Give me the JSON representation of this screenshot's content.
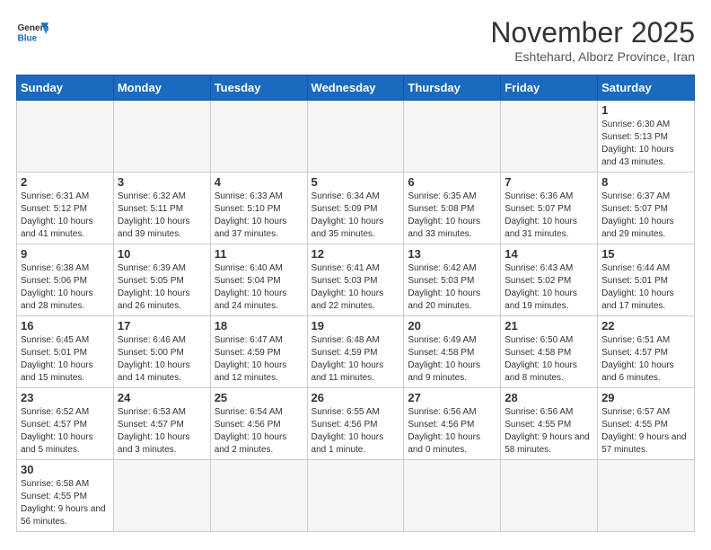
{
  "header": {
    "logo_general": "General",
    "logo_blue": "Blue",
    "month": "November 2025",
    "location": "Eshtehard, Alborz Province, Iran"
  },
  "weekdays": [
    "Sunday",
    "Monday",
    "Tuesday",
    "Wednesday",
    "Thursday",
    "Friday",
    "Saturday"
  ],
  "weeks": [
    {
      "days": [
        {
          "num": "",
          "info": ""
        },
        {
          "num": "",
          "info": ""
        },
        {
          "num": "",
          "info": ""
        },
        {
          "num": "",
          "info": ""
        },
        {
          "num": "",
          "info": ""
        },
        {
          "num": "",
          "info": ""
        },
        {
          "num": "1",
          "info": "Sunrise: 6:30 AM\nSunset: 5:13 PM\nDaylight: 10 hours and 43 minutes."
        }
      ]
    },
    {
      "days": [
        {
          "num": "2",
          "info": "Sunrise: 6:31 AM\nSunset: 5:12 PM\nDaylight: 10 hours and 41 minutes."
        },
        {
          "num": "3",
          "info": "Sunrise: 6:32 AM\nSunset: 5:11 PM\nDaylight: 10 hours and 39 minutes."
        },
        {
          "num": "4",
          "info": "Sunrise: 6:33 AM\nSunset: 5:10 PM\nDaylight: 10 hours and 37 minutes."
        },
        {
          "num": "5",
          "info": "Sunrise: 6:34 AM\nSunset: 5:09 PM\nDaylight: 10 hours and 35 minutes."
        },
        {
          "num": "6",
          "info": "Sunrise: 6:35 AM\nSunset: 5:08 PM\nDaylight: 10 hours and 33 minutes."
        },
        {
          "num": "7",
          "info": "Sunrise: 6:36 AM\nSunset: 5:07 PM\nDaylight: 10 hours and 31 minutes."
        },
        {
          "num": "8",
          "info": "Sunrise: 6:37 AM\nSunset: 5:07 PM\nDaylight: 10 hours and 29 minutes."
        }
      ]
    },
    {
      "days": [
        {
          "num": "9",
          "info": "Sunrise: 6:38 AM\nSunset: 5:06 PM\nDaylight: 10 hours and 28 minutes."
        },
        {
          "num": "10",
          "info": "Sunrise: 6:39 AM\nSunset: 5:05 PM\nDaylight: 10 hours and 26 minutes."
        },
        {
          "num": "11",
          "info": "Sunrise: 6:40 AM\nSunset: 5:04 PM\nDaylight: 10 hours and 24 minutes."
        },
        {
          "num": "12",
          "info": "Sunrise: 6:41 AM\nSunset: 5:03 PM\nDaylight: 10 hours and 22 minutes."
        },
        {
          "num": "13",
          "info": "Sunrise: 6:42 AM\nSunset: 5:03 PM\nDaylight: 10 hours and 20 minutes."
        },
        {
          "num": "14",
          "info": "Sunrise: 6:43 AM\nSunset: 5:02 PM\nDaylight: 10 hours and 19 minutes."
        },
        {
          "num": "15",
          "info": "Sunrise: 6:44 AM\nSunset: 5:01 PM\nDaylight: 10 hours and 17 minutes."
        }
      ]
    },
    {
      "days": [
        {
          "num": "16",
          "info": "Sunrise: 6:45 AM\nSunset: 5:01 PM\nDaylight: 10 hours and 15 minutes."
        },
        {
          "num": "17",
          "info": "Sunrise: 6:46 AM\nSunset: 5:00 PM\nDaylight: 10 hours and 14 minutes."
        },
        {
          "num": "18",
          "info": "Sunrise: 6:47 AM\nSunset: 4:59 PM\nDaylight: 10 hours and 12 minutes."
        },
        {
          "num": "19",
          "info": "Sunrise: 6:48 AM\nSunset: 4:59 PM\nDaylight: 10 hours and 11 minutes."
        },
        {
          "num": "20",
          "info": "Sunrise: 6:49 AM\nSunset: 4:58 PM\nDaylight: 10 hours and 9 minutes."
        },
        {
          "num": "21",
          "info": "Sunrise: 6:50 AM\nSunset: 4:58 PM\nDaylight: 10 hours and 8 minutes."
        },
        {
          "num": "22",
          "info": "Sunrise: 6:51 AM\nSunset: 4:57 PM\nDaylight: 10 hours and 6 minutes."
        }
      ]
    },
    {
      "days": [
        {
          "num": "23",
          "info": "Sunrise: 6:52 AM\nSunset: 4:57 PM\nDaylight: 10 hours and 5 minutes."
        },
        {
          "num": "24",
          "info": "Sunrise: 6:53 AM\nSunset: 4:57 PM\nDaylight: 10 hours and 3 minutes."
        },
        {
          "num": "25",
          "info": "Sunrise: 6:54 AM\nSunset: 4:56 PM\nDaylight: 10 hours and 2 minutes."
        },
        {
          "num": "26",
          "info": "Sunrise: 6:55 AM\nSunset: 4:56 PM\nDaylight: 10 hours and 1 minute."
        },
        {
          "num": "27",
          "info": "Sunrise: 6:56 AM\nSunset: 4:56 PM\nDaylight: 10 hours and 0 minutes."
        },
        {
          "num": "28",
          "info": "Sunrise: 6:56 AM\nSunset: 4:55 PM\nDaylight: 9 hours and 58 minutes."
        },
        {
          "num": "29",
          "info": "Sunrise: 6:57 AM\nSunset: 4:55 PM\nDaylight: 9 hours and 57 minutes."
        }
      ]
    },
    {
      "days": [
        {
          "num": "30",
          "info": "Sunrise: 6:58 AM\nSunset: 4:55 PM\nDaylight: 9 hours and 56 minutes."
        },
        {
          "num": "",
          "info": ""
        },
        {
          "num": "",
          "info": ""
        },
        {
          "num": "",
          "info": ""
        },
        {
          "num": "",
          "info": ""
        },
        {
          "num": "",
          "info": ""
        },
        {
          "num": "",
          "info": ""
        }
      ]
    }
  ]
}
